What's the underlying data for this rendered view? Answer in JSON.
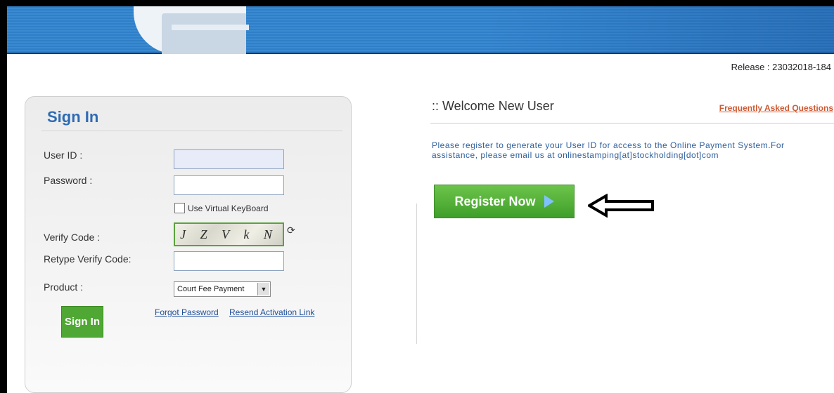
{
  "header": {
    "release": "Release : 23032018-184"
  },
  "signin": {
    "title": "Sign In",
    "user_id_label": "User ID :",
    "password_label": "Password :",
    "virtual_keyboard_label": "Use Virtual KeyBoard",
    "verify_code_label": "Verify Code :",
    "captcha_text": "J Z V k N",
    "retype_label": "Retype Verify Code:",
    "product_label": "Product :",
    "product_selected": "Court Fee Payment",
    "button": "Sign In",
    "forgot_password": "Forgot Password",
    "resend_link": "Resend Activation Link"
  },
  "welcome": {
    "title": ":: Welcome New User",
    "faq": "Frequently Asked Questions",
    "info": "Please register to generate your User ID for access to the Online Payment System.For assistance, please email us at onlinestamping[at]stockholding[dot]com",
    "register_button": "Register Now"
  },
  "colors": {
    "accent_blue": "#2f6bb3",
    "green": "#4fa833",
    "banner": "#2f7fc8"
  }
}
